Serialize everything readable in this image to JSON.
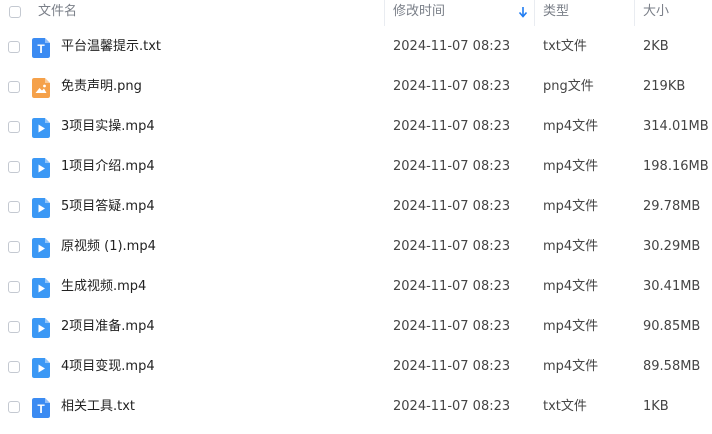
{
  "header": {
    "name_label": "文件名",
    "time_label": "修改时间",
    "type_label": "类型",
    "size_label": "大小"
  },
  "files": [
    {
      "name": "平台温馨提示.txt",
      "modified": "2024-11-07 08:23",
      "type": "txt文件",
      "size": "2KB",
      "icon": "text-file-icon",
      "icon_color": "#3b8bf2"
    },
    {
      "name": "免责声明.png",
      "modified": "2024-11-07 08:23",
      "type": "png文件",
      "size": "219KB",
      "icon": "image-file-icon",
      "icon_color": "#f5a14a"
    },
    {
      "name": "3项目实操.mp4",
      "modified": "2024-11-07 08:23",
      "type": "mp4文件",
      "size": "314.01MB",
      "icon": "video-file-icon",
      "icon_color": "#3b98f5"
    },
    {
      "name": "1项目介绍.mp4",
      "modified": "2024-11-07 08:23",
      "type": "mp4文件",
      "size": "198.16MB",
      "icon": "video-file-icon",
      "icon_color": "#3b98f5"
    },
    {
      "name": "5项目答疑.mp4",
      "modified": "2024-11-07 08:23",
      "type": "mp4文件",
      "size": "29.78MB",
      "icon": "video-file-icon",
      "icon_color": "#3b98f5"
    },
    {
      "name": "原视频 (1).mp4",
      "modified": "2024-11-07 08:23",
      "type": "mp4文件",
      "size": "30.29MB",
      "icon": "video-file-icon",
      "icon_color": "#3b98f5"
    },
    {
      "name": "生成视频.mp4",
      "modified": "2024-11-07 08:23",
      "type": "mp4文件",
      "size": "30.41MB",
      "icon": "video-file-icon",
      "icon_color": "#3b98f5"
    },
    {
      "name": "2项目准备.mp4",
      "modified": "2024-11-07 08:23",
      "type": "mp4文件",
      "size": "90.85MB",
      "icon": "video-file-icon",
      "icon_color": "#3b98f5"
    },
    {
      "name": "4项目变现.mp4",
      "modified": "2024-11-07 08:23",
      "type": "mp4文件",
      "size": "89.58MB",
      "icon": "video-file-icon",
      "icon_color": "#3b98f5"
    },
    {
      "name": "相关工具.txt",
      "modified": "2024-11-07 08:23",
      "type": "txt文件",
      "size": "1KB",
      "icon": "text-file-icon",
      "icon_color": "#3b8bf2"
    }
  ],
  "colors": {
    "sort_arrow": "#1f7cf2",
    "header_text": "#7a7f88"
  }
}
